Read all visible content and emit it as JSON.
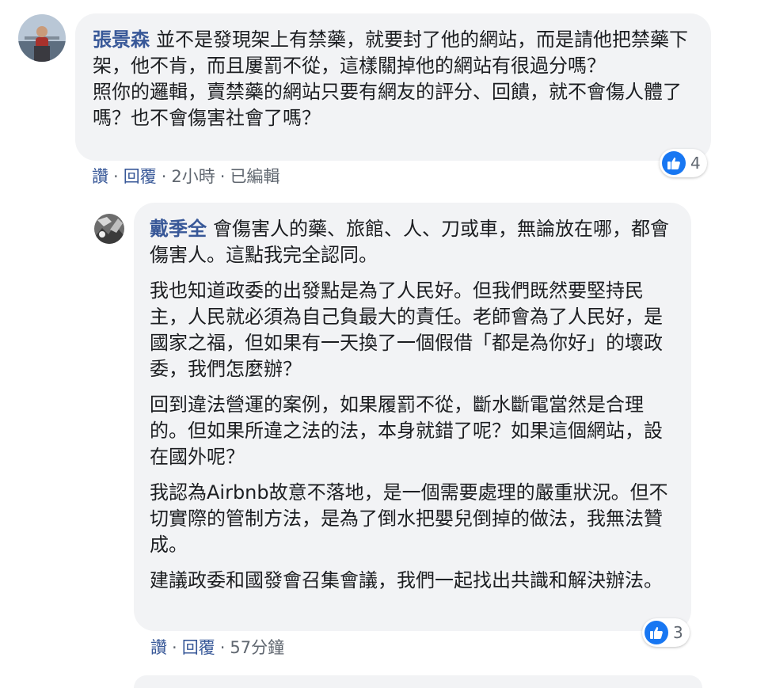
{
  "comments": [
    {
      "author": "張景森",
      "paragraphs": [
        "並不是發現架上有禁藥，就要封了他的網站，而是請他把禁藥下架，他不肯，而且屢罰不從，這樣關掉他的網站有很過分嗎？",
        "照你的邏輯，賣禁藥的網站只要有網友的評分、回饋，就不會傷人體了嗎？也不會傷害社會了嗎？"
      ],
      "actions": {
        "like": "讚",
        "reply": "回覆",
        "time": "2小時",
        "edited": "已編輯"
      },
      "reaction_count": "4"
    },
    {
      "author": "戴季全",
      "paragraphs": [
        "會傷害人的藥、旅館、人、刀或車，無論放在哪，都會傷害人。這點我完全認同。",
        "我也知道政委的出發點是為了人民好。但我們既然要堅持民主，人民就必須為自己負最大的責任。老師會為了人民好，是國家之福，但如果有一天換了一個假借「都是為你好」的壞政委，我們怎麼辦？",
        "回到違法營運的案例，如果履罰不從，斷水斷電當然是合理的。但如果所違之法的法，本身就錯了呢？如果這個網站，設在國外呢？",
        "我認為Airbnb故意不落地，是一個需要處理的嚴重狀況。但不切實際的管制方法，是為了倒水把嬰兒倒掉的做法，我無法贊成。",
        "建議政委和國發會召集會議，我們一起找出共識和解決辦法。"
      ],
      "actions": {
        "like": "讚",
        "reply": "回覆",
        "time": "57分鐘"
      },
      "reaction_count": "3"
    }
  ],
  "icons": {
    "reaction": "like-thumbs-up-icon"
  },
  "colors": {
    "author_name": "#385898",
    "bubble_bg": "#f2f3f5",
    "like_blue": "#1877f2",
    "meta_gray": "#606770"
  }
}
